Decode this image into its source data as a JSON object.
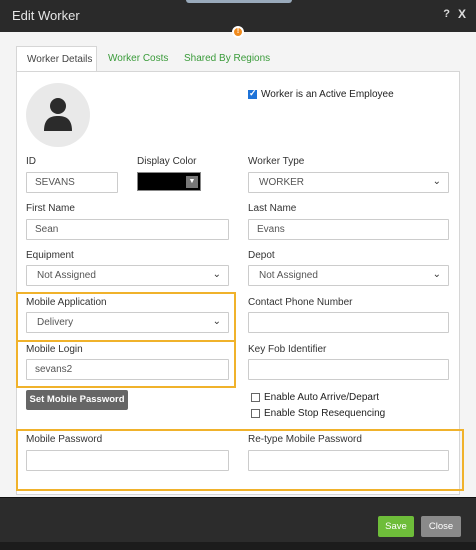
{
  "dialog": {
    "title": "Edit Worker",
    "help_label": "?",
    "close_label": "X",
    "notification_badge": "!"
  },
  "tabs": [
    {
      "label": "Worker Details",
      "active": true
    },
    {
      "label": "Worker Costs",
      "active": false
    },
    {
      "label": "Shared By Regions",
      "active": false
    }
  ],
  "form": {
    "active_employee": {
      "label": "Worker is an Active Employee",
      "checked": true
    },
    "id": {
      "label": "ID",
      "value": "SEVANS"
    },
    "display_color": {
      "label": "Display Color",
      "value": "#000000"
    },
    "worker_type": {
      "label": "Worker Type",
      "value": "WORKER"
    },
    "first_name": {
      "label": "First Name",
      "value": "Sean"
    },
    "last_name": {
      "label": "Last Name",
      "value": "Evans"
    },
    "equipment": {
      "label": "Equipment",
      "value": "Not Assigned"
    },
    "depot": {
      "label": "Depot",
      "value": "Not Assigned"
    },
    "mobile_application": {
      "label": "Mobile Application",
      "value": "Delivery"
    },
    "contact_phone": {
      "label": "Contact Phone Number",
      "value": ""
    },
    "mobile_login": {
      "label": "Mobile Login",
      "value": "sevans2"
    },
    "key_fob": {
      "label": "Key Fob Identifier",
      "value": ""
    },
    "set_mobile_password": {
      "label": "Set Mobile Password"
    },
    "auto_arrive": {
      "label": "Enable Auto Arrive/Depart",
      "checked": false
    },
    "stop_resequencing": {
      "label": "Enable Stop Resequencing",
      "checked": false
    },
    "mobile_password": {
      "label": "Mobile Password",
      "value": ""
    },
    "retype_password": {
      "label": "Re-type Mobile Password",
      "value": ""
    }
  },
  "footer": {
    "save_label": "Save",
    "close_label": "Close"
  },
  "colors": {
    "accent_green": "#6ebd3a",
    "highlight_orange": "#f0b22b",
    "checkbox_blue": "#1e73d8"
  }
}
